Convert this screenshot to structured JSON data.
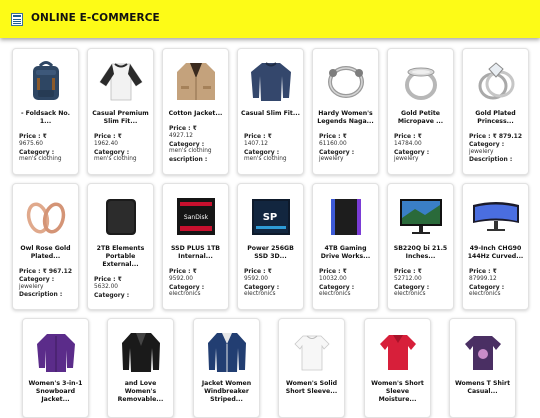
{
  "header": {
    "title": "ONLINE E-COMMERCE",
    "logo_icon": "store-list-icon",
    "bg_color": "#fdfb17"
  },
  "labels": {
    "price": "Price :",
    "category": "Category :",
    "description": "Description :"
  },
  "products": [
    {
      "name": "- Foldsack No. 1...",
      "price": "Price : ₹",
      "price_value": "9675.60",
      "category_label": "Category :",
      "category": "men's clothing",
      "icon": "backpack-icon"
    },
    {
      "name": "Casual Premium Slim Fit...",
      "price": "Price : ₹",
      "price_value": "1962.40",
      "category_label": "Category :",
      "category": "men's clothing",
      "icon": "raglan-tshirt-icon"
    },
    {
      "name": "Cotton Jacket...",
      "price": "Price : ₹",
      "price_value": "4927.12",
      "category_label": "Category :",
      "category": "men's clothing",
      "extra": "escription :",
      "icon": "jacket-icon"
    },
    {
      "name": "Casual Slim Fit...",
      "price": "Price : ₹",
      "price_value": "1407.12",
      "category_label": "Category :",
      "category": "men's clothing",
      "icon": "long-sleeve-shirt-icon"
    },
    {
      "name": "Hardy Women's Legends Naga...",
      "price": "Price : ₹",
      "price_value": "61160.00",
      "category_label": "Category :",
      "category": "jewelery",
      "icon": "bracelet-icon"
    },
    {
      "name": "Gold Petite Micropave ...",
      "price": "Price : ₹",
      "price_value": "14784.00",
      "category_label": "Category :",
      "category": "jewelery",
      "icon": "ring-icon"
    },
    {
      "name": "Gold Plated Princess...",
      "price": "Price : ₹ 879.12",
      "price_value": "",
      "category_label": "Category :",
      "category": "jewelery",
      "extra": "Description :",
      "icon": "diamond-ring-icon"
    },
    {
      "name": "Owl Rose Gold Plated...",
      "price": "Price : ₹ 967.12",
      "price_value": "",
      "category_label": "Category :",
      "category": "jewelery",
      "extra": "Description :",
      "icon": "earrings-icon"
    },
    {
      "name": "2TB Elements Portable External...",
      "price": "Price : ₹",
      "price_value": "5632.00",
      "category_label": "Category :",
      "category": "",
      "icon": "hard-drive-icon"
    },
    {
      "name": "SSD PLUS 1TB Internal...",
      "price": "Price : ₹",
      "price_value": "9592.00",
      "category_label": "Category :",
      "category": "electronics",
      "icon": "ssd-icon"
    },
    {
      "name": "Power 256GB SSD 3D...",
      "price": "Price : ₹",
      "price_value": "9592.00",
      "category_label": "Category :",
      "category": "electronics",
      "icon": "ssd-sp-icon"
    },
    {
      "name": "4TB Gaming Drive Works...",
      "price": "Price : ₹",
      "price_value": "10032.00",
      "category_label": "Category :",
      "category": "electronics",
      "icon": "gaming-drive-icon"
    },
    {
      "name": "SB220Q bi 21.5 Inches...",
      "price": "Price : ₹",
      "price_value": "52712.00",
      "category_label": "Category :",
      "category": "electronics",
      "icon": "monitor-icon"
    },
    {
      "name": "49-Inch CHG90 144Hz Curved...",
      "price": "Price : ₹",
      "price_value": "87999.12",
      "category_label": "Category :",
      "category": "electronics",
      "icon": "curved-monitor-icon"
    },
    {
      "name": "Women's 3-in-1 Snowboard Jacket...",
      "icon": "purple-jacket-icon"
    },
    {
      "name": "and Love Women's Removable...",
      "icon": "leather-jacket-icon"
    },
    {
      "name": "Jacket Women Windbreaker Striped...",
      "icon": "windbreaker-icon"
    },
    {
      "name": "Women's Solid Short Sleeve...",
      "icon": "white-top-icon"
    },
    {
      "name": "Women's Short Sleeve Moisture...",
      "icon": "red-top-icon"
    },
    {
      "name": "Womens T Shirt Casual...",
      "icon": "purple-tshirt-icon"
    }
  ]
}
